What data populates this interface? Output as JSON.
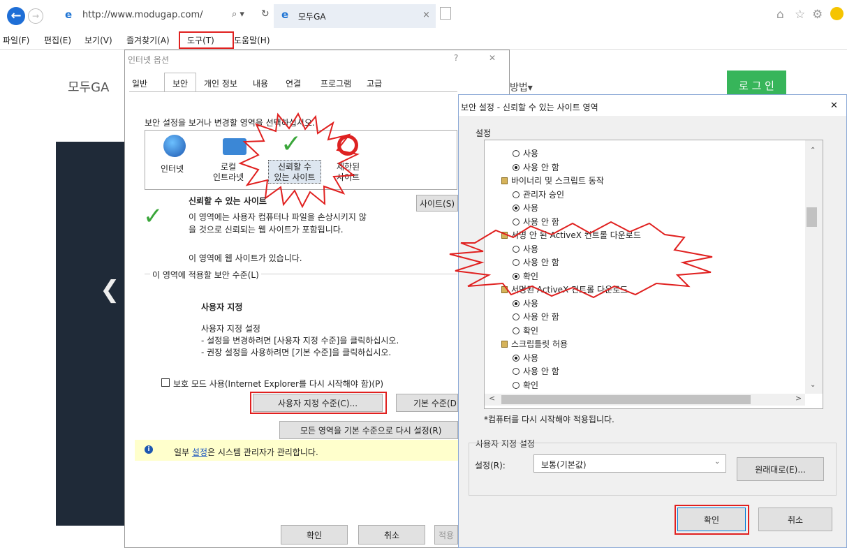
{
  "browser": {
    "url": "http://www.modugap.com/",
    "search_glyph": "⌕ ▾",
    "refresh_glyph": "↻",
    "tab_title": "모두GA",
    "tab_close": "×"
  },
  "menu": {
    "items": [
      "파일(F)",
      "편집(E)",
      "보기(V)",
      "즐겨찾기(A)",
      "도구(T)",
      "도움말(H)"
    ]
  },
  "page": {
    "logo": "모두GA",
    "login": "로 그 인",
    "nav_fragment": "방법▾"
  },
  "internet_options": {
    "title": "인터넷 옵션",
    "help": "?",
    "close": "✕",
    "tabs": [
      "일반",
      "보안",
      "개인 정보",
      "내용",
      "연결",
      "프로그램",
      "고급"
    ],
    "instruction": "보안 설정을 보거나 변경할 영역을 선택하십시오.",
    "zones": [
      "인터넷",
      "로컬\n인트라넷",
      "신뢰할 수\n있는 사이트",
      "제한된\n사이트"
    ],
    "zone_title": "신뢰할 수 있는 사이트",
    "zone_desc": "이 영역에는 사용자 컴퓨터나 파일을 손상시키지 않\n을 것으로 신뢰되는 웹 사이트가 포함됩니다.",
    "zone_status": "이 영역에 웹 사이트가 있습니다.",
    "sites_button": "사이트(S)",
    "level_group": "이 영역에 적용할 보안 수준(L)",
    "level_title": "사용자 지정",
    "level_desc": "사용자 지정 설정\n- 설정을 변경하려면 [사용자 지정 수준]을 클릭하십시오.\n- 권장 설정을 사용하려면 [기본 수준]을 클릭하십시오.",
    "protected_mode": "보호 모드 사용(Internet Explorer를 다시 시작해야 함)(P)",
    "custom_level_button": "사용자 지정 수준(C)...",
    "default_level_button": "기본 수준(D)",
    "reset_all_button": "모든 영역을 기본 수준으로 다시 설정(R)",
    "info_prefix": "일부 ",
    "info_link": "설정",
    "info_suffix": "은 시스템 관리자가 관리합니다.",
    "ok": "확인",
    "cancel": "취소",
    "apply": "적용"
  },
  "security_settings": {
    "title": "보안 설정 - 신뢰할 수 있는 사이트 영역",
    "close": "✕",
    "group_label": "설정",
    "rows": [
      {
        "kind": "radio",
        "label": "사용",
        "checked": false
      },
      {
        "kind": "radio",
        "label": "사용 안 함",
        "checked": true
      },
      {
        "kind": "category",
        "label": "바이너리 및 스크립트 동작"
      },
      {
        "kind": "radio",
        "label": "관리자 승인",
        "checked": false
      },
      {
        "kind": "radio",
        "label": "사용",
        "checked": true
      },
      {
        "kind": "radio",
        "label": "사용 안 함",
        "checked": false
      },
      {
        "kind": "category",
        "label": "서명 안 된 ActiveX 컨트롤 다운로드"
      },
      {
        "kind": "radio",
        "label": "사용",
        "checked": false
      },
      {
        "kind": "radio",
        "label": "사용 안 함",
        "checked": false
      },
      {
        "kind": "radio",
        "label": "확인",
        "checked": true
      },
      {
        "kind": "category",
        "label": "서명된 ActiveX 컨트롤 다운로드"
      },
      {
        "kind": "radio",
        "label": "사용",
        "checked": true
      },
      {
        "kind": "radio",
        "label": "사용 안 함",
        "checked": false
      },
      {
        "kind": "radio",
        "label": "확인",
        "checked": false
      },
      {
        "kind": "category",
        "label": "스크립틀릿 허용"
      },
      {
        "kind": "radio",
        "label": "사용",
        "checked": true
      },
      {
        "kind": "radio",
        "label": "사용 안 함",
        "checked": false
      },
      {
        "kind": "radio",
        "label": "확인",
        "checked": false
      }
    ],
    "restart_note": "*컴퓨터를 다시 시작해야 적용됩니다.",
    "reset_group": "사용자 지정 설정",
    "reset_to_label": "설정(R):",
    "reset_to_value": "보통(기본값)",
    "reset_button": "원래대로(E)...",
    "ok": "확인",
    "cancel": "취소"
  },
  "colors": {
    "highlight_red": "#e0201f",
    "login_green": "#37b55a",
    "ie_blue": "#1e6ed6"
  }
}
